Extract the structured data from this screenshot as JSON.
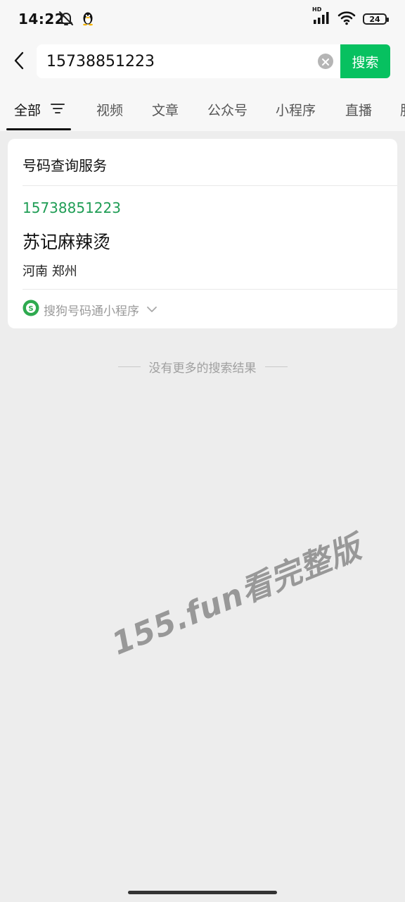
{
  "status_bar": {
    "time": "14:22",
    "battery": "24",
    "network_badge": "HD"
  },
  "search": {
    "query": "15738851223",
    "submit_label": "搜索"
  },
  "tabs": [
    {
      "label": "全部",
      "active": true
    },
    {
      "label": "视频",
      "active": false
    },
    {
      "label": "文章",
      "active": false
    },
    {
      "label": "公众号",
      "active": false
    },
    {
      "label": "小程序",
      "active": false
    },
    {
      "label": "直播",
      "active": false
    },
    {
      "label": "服",
      "active": false
    }
  ],
  "result_card": {
    "title": "号码查询服务",
    "phone": "15738851223",
    "name": "苏记麻辣烫",
    "location": "河南 郑州",
    "source": "搜狗号码通小程序"
  },
  "footer_note": "没有更多的搜索结果",
  "watermark": "155.fun看完整版",
  "colors": {
    "accent_green": "#07c160",
    "phone_green": "#1f9d55",
    "background": "#ededed"
  }
}
